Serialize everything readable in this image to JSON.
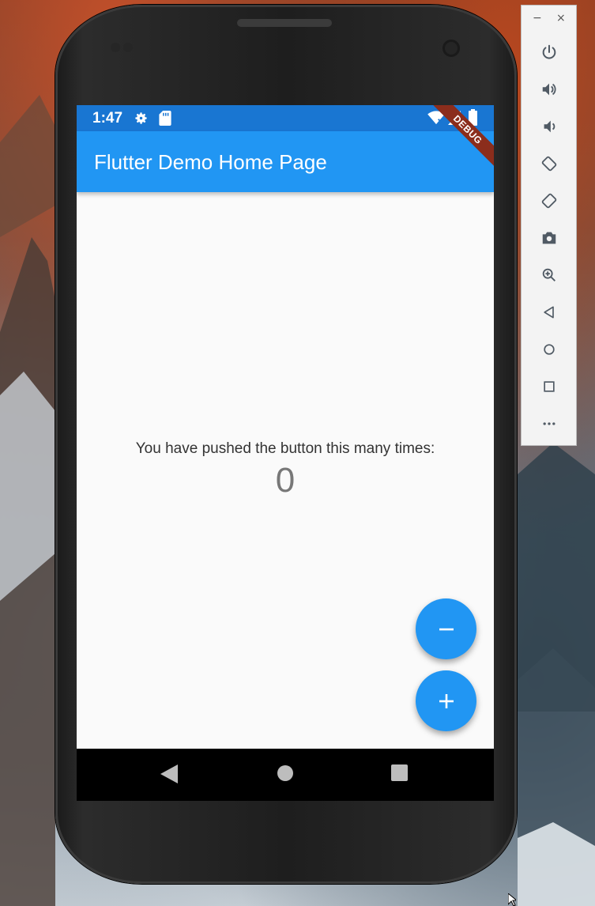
{
  "status_bar": {
    "time": "1:47",
    "icons": [
      "settings-icon",
      "sd-card-icon",
      "wifi-icon",
      "signal-icon",
      "battery-icon"
    ]
  },
  "app_bar": {
    "title": "Flutter Demo Home Page",
    "debug_banner": "DEBUG"
  },
  "main": {
    "message": "You have pushed the button this many times:",
    "counter": "0"
  },
  "fabs": [
    {
      "name": "decrement",
      "label": "−"
    },
    {
      "name": "increment",
      "label": "+"
    }
  ],
  "nav_bar": {
    "buttons": [
      "back-icon",
      "home-icon",
      "recents-icon"
    ]
  },
  "emulator_panel": {
    "window_buttons": {
      "minimize": "−",
      "close": "×"
    },
    "tools": [
      "power-icon",
      "volume-up-icon",
      "volume-down-icon",
      "rotate-left-icon",
      "rotate-right-icon",
      "camera-icon",
      "zoom-icon",
      "back-icon",
      "home-icon",
      "overview-icon",
      "more-icon"
    ]
  },
  "colors": {
    "primary": "#2196f3",
    "primary_dark": "#1976d2",
    "debug_banner": "#8b2d1c",
    "background": "#fafafa"
  }
}
